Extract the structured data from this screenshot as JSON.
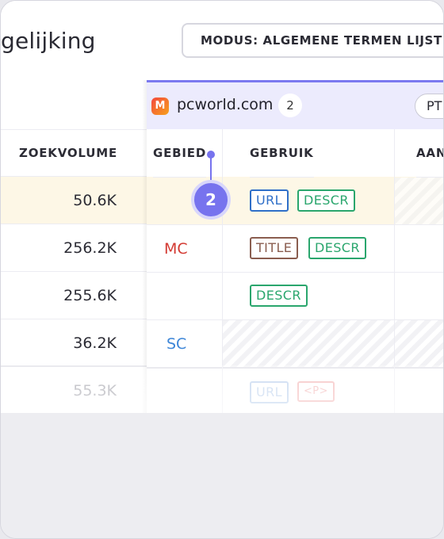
{
  "header": {
    "title": "gelijking",
    "mode_button": "MODUS: ALGEMENE TERMEN LIJST"
  },
  "left_table": {
    "column": "ZOEKVOLUME",
    "rows": [
      "50.6K",
      "256.2K",
      "255.6K",
      "36.2K",
      "55.3K"
    ]
  },
  "site": {
    "icon": "M",
    "name": "pcworld.com",
    "count": "2",
    "next_pill": "PT"
  },
  "columns": {
    "gebied": "GEBIED",
    "gebruik": "GEBRUIK",
    "next": "AAN"
  },
  "rows": [
    {
      "gebied": "",
      "tags": [
        "URL",
        "DESCR"
      ]
    },
    {
      "gebied": "MC",
      "tags": [
        "TITLE",
        "DESCR"
      ]
    },
    {
      "gebied": "",
      "tags": [
        "DESCR"
      ]
    },
    {
      "gebied": "SC",
      "tags": []
    },
    {
      "gebied": "",
      "tags": [
        "URL",
        "<P>"
      ]
    }
  ],
  "step_marker": "2",
  "colors": {
    "accent": "#7773ee",
    "highlight_row": "#fdf7e6",
    "url": "#2f6fc8",
    "descr": "#2aa66d",
    "title": "#8a5d4f",
    "p": "#e23b3b",
    "mc": "#d33a32",
    "sc": "#3d86d8"
  }
}
